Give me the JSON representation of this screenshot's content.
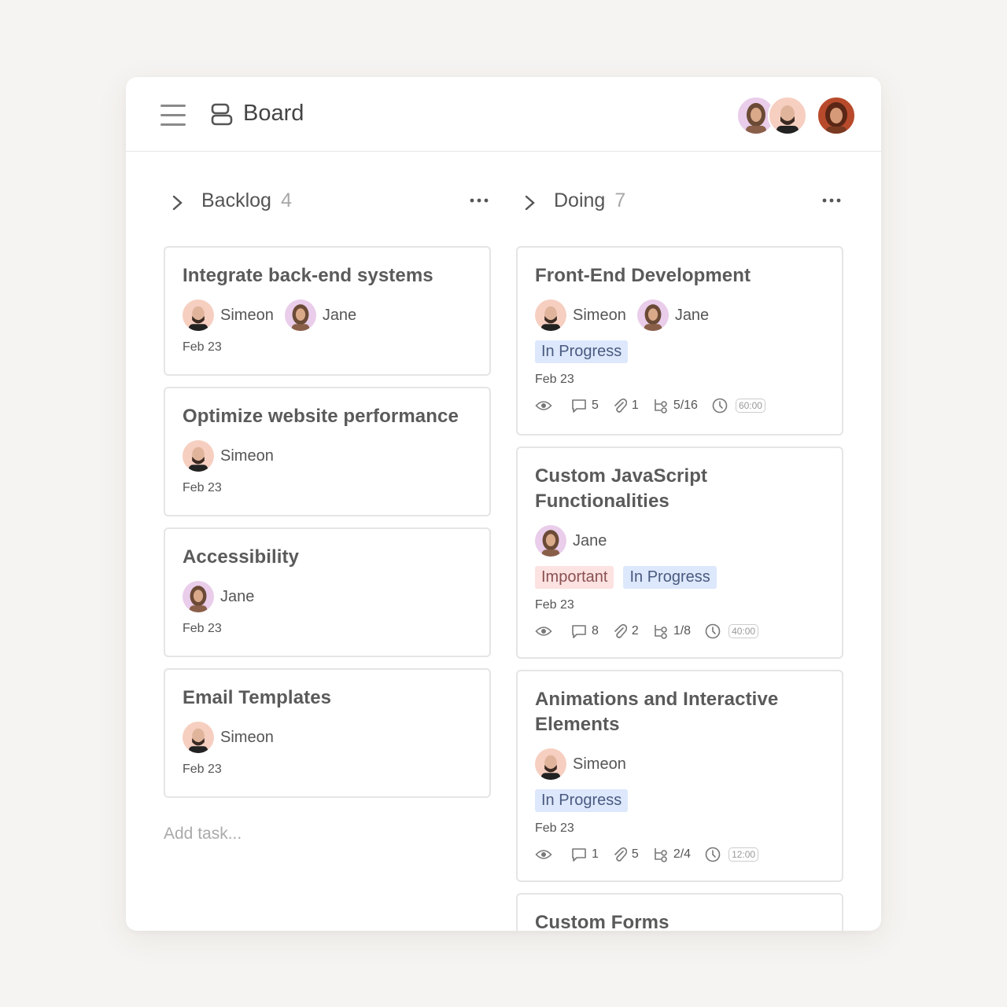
{
  "header": {
    "title": "Board",
    "avatars": [
      "jane",
      "simeon",
      "third-user"
    ]
  },
  "columns": [
    {
      "title": "Backlog",
      "count": "4",
      "cards": [
        {
          "title": "Integrate back-end systems",
          "assignees": [
            "Simeon",
            "Jane"
          ],
          "date": "Feb 23"
        },
        {
          "title": "Optimize website performance",
          "assignees": [
            "Simeon"
          ],
          "date": "Feb 23"
        },
        {
          "title": "Accessibility",
          "assignees": [
            "Jane"
          ],
          "date": "Feb 23"
        },
        {
          "title": "Email Templates",
          "assignees": [
            "Simeon"
          ],
          "date": "Feb 23"
        }
      ],
      "add_task": "Add task..."
    },
    {
      "title": "Doing",
      "count": "7",
      "cards": [
        {
          "title": "Front-End Development",
          "assignees": [
            "Simeon",
            "Jane"
          ],
          "tags": [
            "In Progress"
          ],
          "date": "Feb 23",
          "comments": "5",
          "attachments": "1",
          "subtasks": "5/16",
          "time": "60:00"
        },
        {
          "title": "Custom JavaScript Functionalities",
          "assignees": [
            "Jane"
          ],
          "tags": [
            "Important",
            "In Progress"
          ],
          "date": "Feb 23",
          "comments": "8",
          "attachments": "2",
          "subtasks": "1/8",
          "time": "40:00"
        },
        {
          "title": "Animations and Interactive Elements",
          "assignees": [
            "Simeon"
          ],
          "tags": [
            "In Progress"
          ],
          "date": "Feb 23",
          "comments": "1",
          "attachments": "5",
          "subtasks": "2/4",
          "time": "12:00"
        },
        {
          "title": "Custom Forms"
        }
      ]
    }
  ],
  "colors": {
    "in_progress_tag": "#dde8fc",
    "important_tag": "#fde2e2",
    "card_border": "#e5e5e5",
    "background": "#f6f4f2"
  }
}
